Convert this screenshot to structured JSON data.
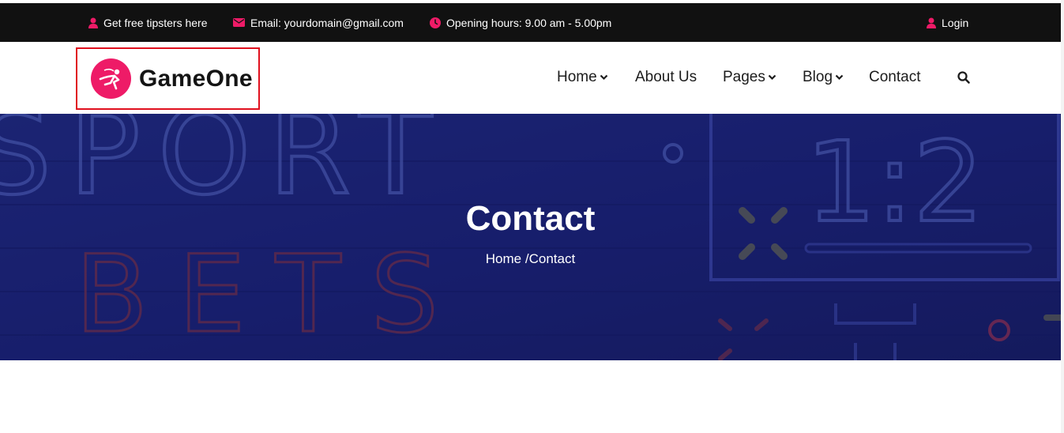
{
  "topbar": {
    "tipsters": "Get free tipsters here",
    "email": "Email: yourdomain@gmail.com",
    "hours": "Opening hours: 9.00 am - 5.00pm",
    "login": "Login"
  },
  "header": {
    "logo_text": "GameOne",
    "nav": [
      "Home",
      "About Us",
      "Pages",
      "Blog",
      "Contact"
    ]
  },
  "hero": {
    "title": "Contact",
    "breadcrumb_home": "Home",
    "breadcrumb_sep": "/",
    "breadcrumb_current": "Contact",
    "background_words": [
      "SPORT",
      "BETS",
      "1:2"
    ]
  },
  "colors": {
    "accent": "#ee1b67",
    "topbar_bg": "#111111",
    "hero_bg": "#1a1f6b",
    "highlight_border": "#e0101e"
  }
}
